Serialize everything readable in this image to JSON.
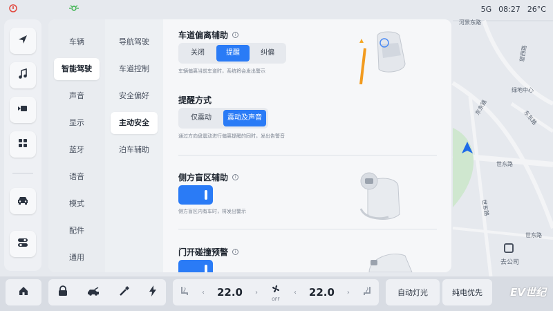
{
  "status": {
    "network": "5G",
    "time": "08:27",
    "temperature": "26°C"
  },
  "map": {
    "labels": [
      "河景东路",
      "望西路",
      "绿地中心",
      "东东路",
      "东东路",
      "世东路",
      "世东路",
      "世东路",
      "去公司"
    ]
  },
  "dock": {
    "items": [
      "navigation-icon",
      "music-icon",
      "video-icon",
      "apps-icon",
      "car-icon",
      "settings-toggle-icon"
    ]
  },
  "menu1": {
    "items": [
      "车辆",
      "智能驾驶",
      "声音",
      "显示",
      "蓝牙",
      "语音",
      "模式",
      "配件",
      "通用"
    ],
    "active_index": 1
  },
  "menu2": {
    "items": [
      "导航驾驶",
      "车道控制",
      "安全偏好",
      "主动安全",
      "泊车辅助"
    ],
    "active_index": 3
  },
  "content": {
    "lane_assist": {
      "title": "车道偏离辅助",
      "options": [
        "关闭",
        "提醒",
        "纠偏"
      ],
      "selected": "提醒",
      "desc": "车辆偏离当前车道时，系统将会发出警示"
    },
    "alert_mode": {
      "title": "提醒方式",
      "options": [
        "仅震动",
        "震动及声音"
      ],
      "selected": "震动及声音",
      "desc": "通过方向盘震动进行偏离提醒的同时，发出告警音"
    },
    "blind_spot": {
      "title": "侧方盲区辅助",
      "enabled": true,
      "desc": "侧方盲区内有车时，将发出警示"
    },
    "door_warning": {
      "title": "门开碰撞预警",
      "enabled": true
    }
  },
  "bottom": {
    "left_temp": "22.0",
    "right_temp": "22.0",
    "fan_label": "OFF",
    "auto_light": "自动灯光",
    "ev_priority": "纯电优先",
    "watermark": "EV世纪"
  },
  "colors": {
    "accent": "#2a7bf6",
    "nav_arrow": "#1e6be8"
  }
}
